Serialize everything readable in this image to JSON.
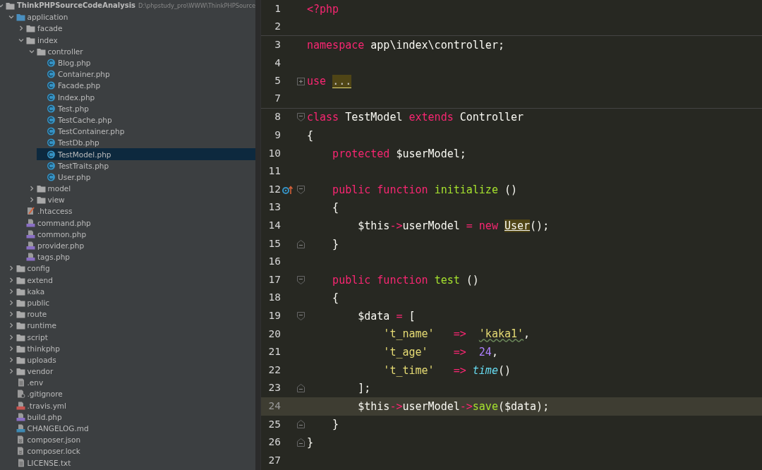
{
  "project_tree": {
    "root": {
      "label": "ThinkPHPSourceCodeAnalysis",
      "path": "D:\\phpstudy_pro\\WWW\\ThinkPHPSource",
      "expanded": true,
      "selected": false,
      "kind": "folder",
      "children": [
        {
          "label": "application",
          "kind": "source-folder",
          "expanded": true,
          "selected": false,
          "children": [
            {
              "label": "facade",
              "kind": "folder",
              "expanded": false,
              "selected": false
            },
            {
              "label": "index",
              "kind": "folder",
              "expanded": true,
              "selected": false,
              "children": [
                {
                  "label": "controller",
                  "kind": "folder",
                  "expanded": true,
                  "selected": false,
                  "children": [
                    {
                      "label": "Blog.php",
                      "kind": "class",
                      "selected": false
                    },
                    {
                      "label": "Container.php",
                      "kind": "class",
                      "selected": false
                    },
                    {
                      "label": "Facade.php",
                      "kind": "class",
                      "selected": false
                    },
                    {
                      "label": "Index.php",
                      "kind": "class",
                      "selected": false
                    },
                    {
                      "label": "Test.php",
                      "kind": "class",
                      "selected": false
                    },
                    {
                      "label": "TestCache.php",
                      "kind": "class",
                      "selected": false
                    },
                    {
                      "label": "TestContainer.php",
                      "kind": "class",
                      "selected": false
                    },
                    {
                      "label": "TestDb.php",
                      "kind": "class",
                      "selected": false
                    },
                    {
                      "label": "TestModel.php",
                      "kind": "class",
                      "selected": true
                    },
                    {
                      "label": "TestTraits.php",
                      "kind": "class",
                      "selected": false
                    },
                    {
                      "label": "User.php",
                      "kind": "class",
                      "selected": false
                    }
                  ]
                },
                {
                  "label": "model",
                  "kind": "folder",
                  "expanded": false,
                  "selected": false
                },
                {
                  "label": "view",
                  "kind": "folder",
                  "expanded": false,
                  "selected": false
                }
              ]
            },
            {
              "label": ".htaccess",
              "kind": "htaccess",
              "selected": false
            },
            {
              "label": "command.php",
              "kind": "php",
              "selected": false
            },
            {
              "label": "common.php",
              "kind": "php",
              "selected": false
            },
            {
              "label": "provider.php",
              "kind": "php",
              "selected": false
            },
            {
              "label": "tags.php",
              "kind": "php",
              "selected": false
            }
          ]
        },
        {
          "label": "config",
          "kind": "folder",
          "expanded": false,
          "selected": false
        },
        {
          "label": "extend",
          "kind": "folder",
          "expanded": false,
          "selected": false
        },
        {
          "label": "kaka",
          "kind": "folder",
          "expanded": false,
          "selected": false
        },
        {
          "label": "public",
          "kind": "folder",
          "expanded": false,
          "selected": false
        },
        {
          "label": "route",
          "kind": "folder",
          "expanded": false,
          "selected": false
        },
        {
          "label": "runtime",
          "kind": "folder",
          "expanded": false,
          "selected": false
        },
        {
          "label": "script",
          "kind": "folder",
          "expanded": false,
          "selected": false
        },
        {
          "label": "thinkphp",
          "kind": "folder",
          "expanded": false,
          "selected": false
        },
        {
          "label": "uploads",
          "kind": "folder",
          "expanded": false,
          "selected": false
        },
        {
          "label": "vendor",
          "kind": "folder",
          "expanded": false,
          "selected": false
        },
        {
          "label": ".env",
          "kind": "text",
          "selected": false
        },
        {
          "label": ".gitignore",
          "kind": "ignore",
          "selected": false
        },
        {
          "label": ".travis.yml",
          "kind": "yml",
          "selected": false
        },
        {
          "label": "build.php",
          "kind": "php",
          "selected": false
        },
        {
          "label": "CHANGELOG.md",
          "kind": "md",
          "selected": false
        },
        {
          "label": "composer.json",
          "kind": "composer",
          "selected": false
        },
        {
          "label": "composer.lock",
          "kind": "composer",
          "selected": false
        },
        {
          "label": "LICENSE.txt",
          "kind": "text",
          "selected": false
        }
      ]
    }
  },
  "editor": {
    "lines": [
      {
        "number": "1",
        "tokens": [
          {
            "kind": "keyword",
            "text": "<?php"
          }
        ],
        "fold_start": false,
        "fold_end": false,
        "folded": false,
        "current": false,
        "separator_below": false,
        "gutter_marker": false
      },
      {
        "number": "2",
        "fold_start": false,
        "fold_end": false,
        "folded": false,
        "current": false,
        "separator_below": true,
        "gutter_marker": false
      },
      {
        "number": "3",
        "tokens": [
          {
            "kind": "keyword",
            "text": "namespace "
          },
          {
            "kind": "plain",
            "text": "app\\index\\controller;"
          }
        ],
        "fold_start": false,
        "fold_end": false,
        "folded": false,
        "current": false,
        "separator_below": false,
        "gutter_marker": false
      },
      {
        "number": "4",
        "fold_start": false,
        "fold_end": false,
        "folded": false,
        "current": false,
        "separator_below": false,
        "gutter_marker": false
      },
      {
        "number": "5",
        "tokens": [
          {
            "kind": "keyword",
            "text": "use "
          },
          {
            "kind": "folded",
            "text": "..."
          }
        ],
        "fold_start": false,
        "fold_end": false,
        "folded": true,
        "current": false,
        "separator_below": false,
        "gutter_marker": false
      },
      {
        "number": "7",
        "fold_start": false,
        "fold_end": false,
        "folded": false,
        "current": false,
        "separator_below": true,
        "gutter_marker": false
      },
      {
        "number": "8",
        "tokens": [
          {
            "kind": "keyword",
            "text": "class "
          },
          {
            "kind": "plain",
            "text": "TestModel "
          },
          {
            "kind": "keyword",
            "text": "extends "
          },
          {
            "kind": "plain",
            "text": "Controller"
          }
        ],
        "fold_start": true,
        "fold_end": false,
        "folded": false,
        "current": false,
        "separator_below": false,
        "gutter_marker": false
      },
      {
        "number": "9",
        "tokens": [
          {
            "kind": "plain",
            "text": "{"
          }
        ],
        "fold_start": false,
        "fold_end": false,
        "folded": false,
        "current": false,
        "separator_below": false,
        "gutter_marker": false
      },
      {
        "number": "10",
        "tokens": [
          {
            "kind": "keyword",
            "text": "    protected "
          },
          {
            "kind": "plain",
            "text": "$userModel;"
          }
        ],
        "fold_start": false,
        "fold_end": false,
        "folded": false,
        "current": false,
        "separator_below": false,
        "gutter_marker": false
      },
      {
        "number": "11",
        "fold_start": false,
        "fold_end": false,
        "folded": false,
        "current": false,
        "separator_below": false,
        "gutter_marker": false
      },
      {
        "number": "12",
        "tokens": [
          {
            "kind": "keyword",
            "text": "    public function "
          },
          {
            "kind": "function",
            "text": "initialize"
          },
          {
            "kind": "plain",
            "text": " ()"
          }
        ],
        "fold_start": true,
        "fold_end": false,
        "folded": false,
        "current": false,
        "separator_below": false,
        "gutter_marker": true
      },
      {
        "number": "13",
        "tokens": [
          {
            "kind": "plain",
            "text": "    {"
          }
        ],
        "fold_start": false,
        "fold_end": false,
        "folded": false,
        "current": false,
        "separator_below": false,
        "gutter_marker": false
      },
      {
        "number": "14",
        "tokens": [
          {
            "kind": "plain",
            "text": "        $this"
          },
          {
            "kind": "keyword",
            "text": "->"
          },
          {
            "kind": "plain",
            "text": "userModel "
          },
          {
            "kind": "keyword",
            "text": "= new "
          },
          {
            "kind": "highlight",
            "text": "User"
          },
          {
            "kind": "plain",
            "text": "();"
          }
        ],
        "fold_start": false,
        "fold_end": false,
        "folded": false,
        "current": false,
        "separator_below": false,
        "gutter_marker": false
      },
      {
        "number": "15",
        "tokens": [
          {
            "kind": "plain",
            "text": "    }"
          }
        ],
        "fold_start": false,
        "fold_end": true,
        "folded": false,
        "current": false,
        "separator_below": false,
        "gutter_marker": false
      },
      {
        "number": "16",
        "fold_start": false,
        "fold_end": false,
        "folded": false,
        "current": false,
        "separator_below": false,
        "gutter_marker": false
      },
      {
        "number": "17",
        "tokens": [
          {
            "kind": "keyword",
            "text": "    public function "
          },
          {
            "kind": "function",
            "text": "test"
          },
          {
            "kind": "plain",
            "text": " ()"
          }
        ],
        "fold_start": true,
        "fold_end": false,
        "folded": false,
        "current": false,
        "separator_below": false,
        "gutter_marker": false
      },
      {
        "number": "18",
        "tokens": [
          {
            "kind": "plain",
            "text": "    {"
          }
        ],
        "fold_start": false,
        "fold_end": false,
        "folded": false,
        "current": false,
        "separator_below": false,
        "gutter_marker": false
      },
      {
        "number": "19",
        "tokens": [
          {
            "kind": "plain",
            "text": "        $data "
          },
          {
            "kind": "keyword",
            "text": "="
          },
          {
            "kind": "plain",
            "text": " ["
          }
        ],
        "fold_start": true,
        "fold_end": false,
        "folded": false,
        "current": false,
        "separator_below": false,
        "gutter_marker": false
      },
      {
        "number": "20",
        "tokens": [
          {
            "kind": "string",
            "text": "            't_name'   "
          },
          {
            "kind": "keyword",
            "text": "=>  "
          },
          {
            "kind": "string-typo",
            "text": "'kaka1'"
          },
          {
            "kind": "plain",
            "text": ","
          }
        ],
        "fold_start": false,
        "fold_end": false,
        "folded": false,
        "current": false,
        "separator_below": false,
        "gutter_marker": false
      },
      {
        "number": "21",
        "tokens": [
          {
            "kind": "string",
            "text": "            't_age'    "
          },
          {
            "kind": "keyword",
            "text": "=>  "
          },
          {
            "kind": "number",
            "text": "24"
          },
          {
            "kind": "plain",
            "text": ","
          }
        ],
        "fold_start": false,
        "fold_end": false,
        "folded": false,
        "current": false,
        "separator_below": false,
        "gutter_marker": false
      },
      {
        "number": "22",
        "tokens": [
          {
            "kind": "string",
            "text": "            't_time'   "
          },
          {
            "kind": "keyword",
            "text": "=> "
          },
          {
            "kind": "builtin",
            "text": "time"
          },
          {
            "kind": "plain",
            "text": "()"
          }
        ],
        "fold_start": false,
        "fold_end": false,
        "folded": false,
        "current": false,
        "separator_below": false,
        "gutter_marker": false
      },
      {
        "number": "23",
        "tokens": [
          {
            "kind": "plain",
            "text": "        ];"
          }
        ],
        "fold_start": false,
        "fold_end": true,
        "folded": false,
        "current": false,
        "separator_below": false,
        "gutter_marker": false
      },
      {
        "number": "24",
        "tokens": [
          {
            "kind": "plain",
            "text": "        $this"
          },
          {
            "kind": "keyword",
            "text": "->"
          },
          {
            "kind": "plain",
            "text": "userModel"
          },
          {
            "kind": "keyword",
            "text": "->"
          },
          {
            "kind": "function",
            "text": "save"
          },
          {
            "kind": "plain",
            "text": "($data);"
          }
        ],
        "fold_start": false,
        "fold_end": false,
        "folded": false,
        "current": true,
        "separator_below": false,
        "gutter_marker": false
      },
      {
        "number": "25",
        "tokens": [
          {
            "kind": "plain",
            "text": "    }"
          }
        ],
        "fold_start": false,
        "fold_end": true,
        "folded": false,
        "current": false,
        "separator_below": false,
        "gutter_marker": false
      },
      {
        "number": "26",
        "tokens": [
          {
            "kind": "plain",
            "text": "}"
          }
        ],
        "fold_start": false,
        "fold_end": true,
        "folded": false,
        "current": false,
        "separator_below": false,
        "gutter_marker": false
      },
      {
        "number": "27",
        "fold_start": false,
        "fold_end": false,
        "folded": false,
        "current": false,
        "separator_below": false,
        "gutter_marker": false
      }
    ]
  }
}
